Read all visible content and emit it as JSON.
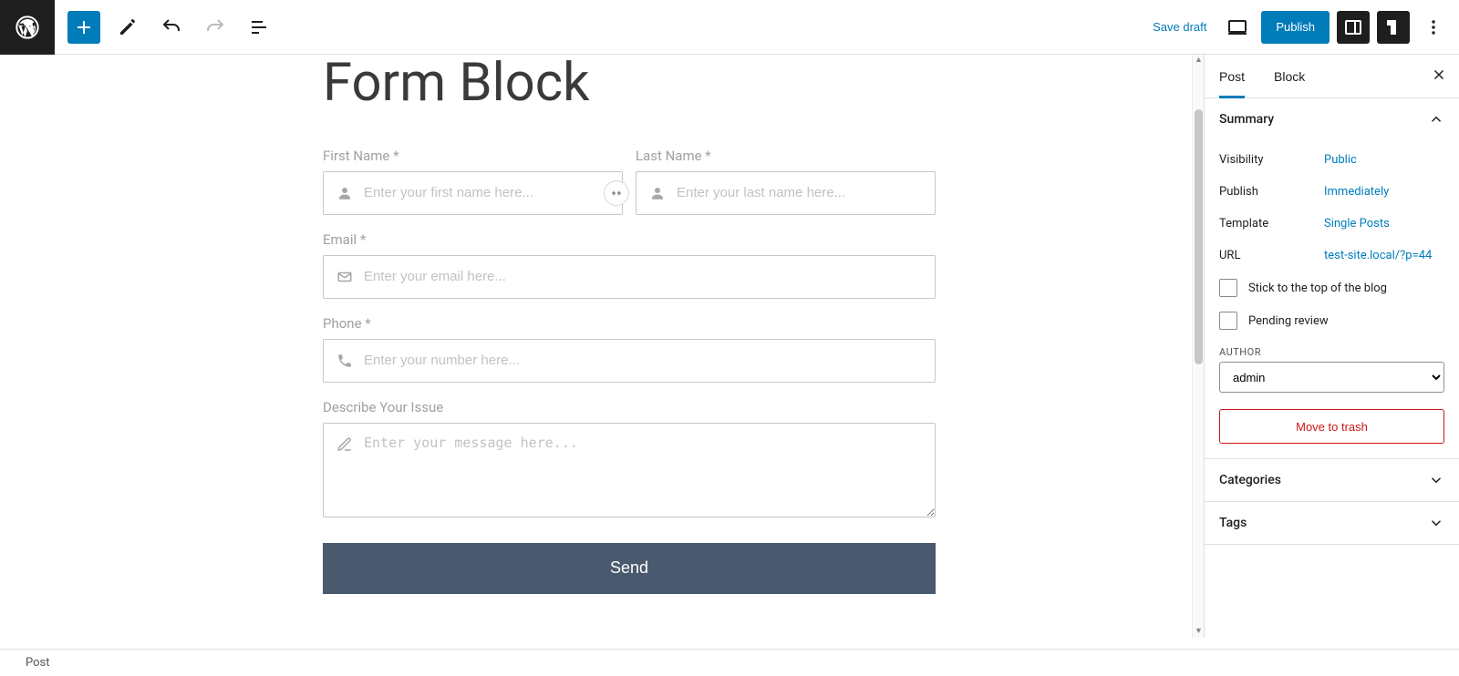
{
  "toolbar": {
    "save_draft": "Save draft",
    "publish": "Publish"
  },
  "page": {
    "title": "Form Block"
  },
  "form": {
    "first_name": {
      "label": "First Name *",
      "placeholder": "Enter your first name here..."
    },
    "last_name": {
      "label": "Last Name *",
      "placeholder": "Enter your last name here..."
    },
    "email": {
      "label": "Email *",
      "placeholder": "Enter your email here..."
    },
    "phone": {
      "label": "Phone *",
      "placeholder": "Enter your number here..."
    },
    "message": {
      "label": "Describe Your Issue",
      "placeholder": "Enter your message here..."
    },
    "submit": "Send"
  },
  "sidebar": {
    "tabs": {
      "post": "Post",
      "block": "Block"
    },
    "summary": {
      "title": "Summary",
      "visibility_label": "Visibility",
      "visibility_value": "Public",
      "publish_label": "Publish",
      "publish_value": "Immediately",
      "template_label": "Template",
      "template_value": "Single Posts",
      "url_label": "URL",
      "url_value": "test-site.local/?p=44",
      "stick_label": "Stick to the top of the blog",
      "pending_label": "Pending review",
      "author_label": "AUTHOR",
      "author_value": "admin",
      "trash": "Move to trash"
    },
    "categories": "Categories",
    "tags": "Tags"
  },
  "footer": {
    "breadcrumb": "Post"
  }
}
